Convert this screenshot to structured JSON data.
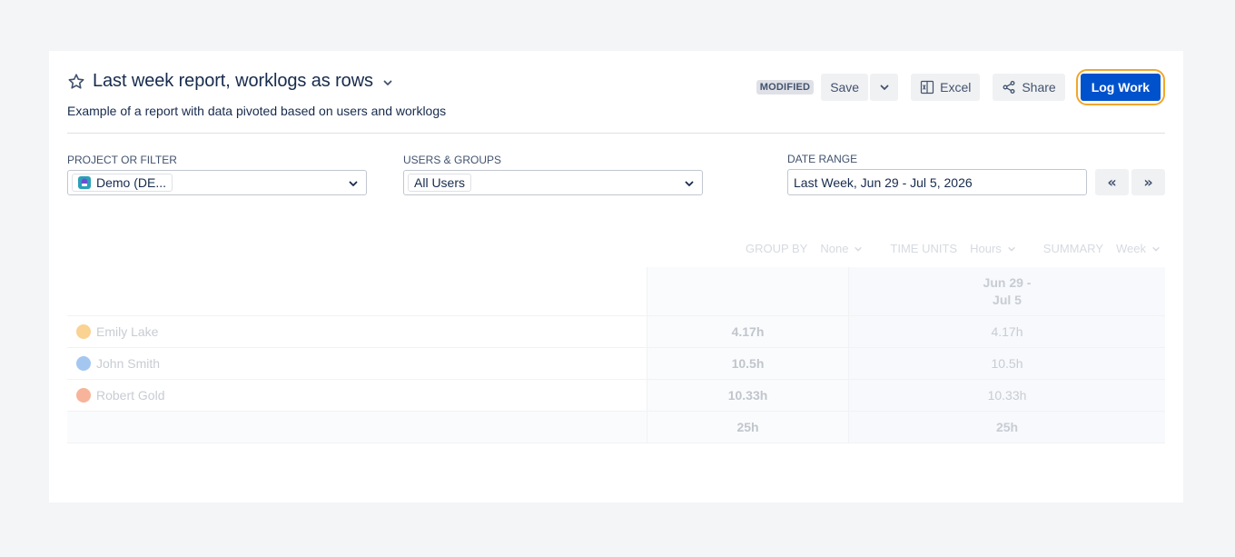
{
  "report": {
    "title": "Last week report, worklogs as rows",
    "description": "Example of a report with data pivoted based on users and worklogs"
  },
  "actions": {
    "status_badge": "MODIFIED",
    "save_label": "Save",
    "excel_label": "Excel",
    "share_label": "Share",
    "log_work_label": "Log Work"
  },
  "filters": {
    "project_label": "PROJECT OR FILTER",
    "project_value": "Demo (DE...",
    "users_label": "USERS & GROUPS",
    "users_value": "All Users",
    "date_label": "DATE RANGE",
    "date_value": "Last Week, Jun 29 - Jul 5, 2026",
    "prev_label": "«",
    "next_label": "»"
  },
  "controls": {
    "group_by_label": "GROUP BY",
    "group_by_value": "None",
    "time_units_label": "TIME UNITS",
    "time_units_value": "Hours",
    "summary_label": "SUMMARY",
    "summary_value": "Week"
  },
  "table": {
    "period_header_line1": "Jun 29 -",
    "period_header_line2": "Jul 5",
    "rows": [
      {
        "name": "Emily Lake",
        "total": "4.17h",
        "period": "4.17h",
        "avatar_color": "#f5a623"
      },
      {
        "name": "John Smith",
        "total": "10.5h",
        "period": "10.5h",
        "avatar_color": "#4a90e2"
      },
      {
        "name": "Robert Gold",
        "total": "10.33h",
        "period": "10.33h",
        "avatar_color": "#f06a35"
      }
    ],
    "grand_total": "25h",
    "grand_period": "25h"
  },
  "colors": {
    "primary": "#0052cc",
    "focus_ring": "#f0a72c"
  }
}
